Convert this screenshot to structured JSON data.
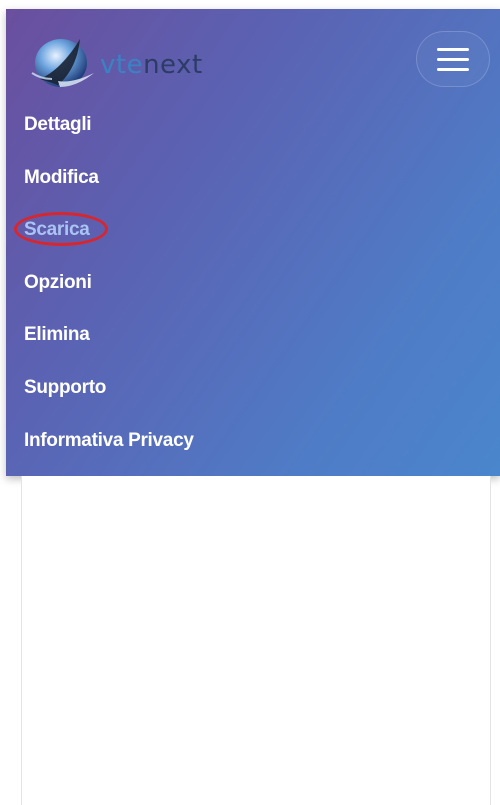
{
  "header": {
    "logo_text_vte": "vte",
    "logo_text_next": "next",
    "menu_button_label": "Menu"
  },
  "nav": {
    "items": [
      {
        "label": "Dettagli"
      },
      {
        "label": "Modifica"
      },
      {
        "label": "Scarica",
        "highlighted": true
      },
      {
        "label": "Opzioni"
      },
      {
        "label": "Elimina"
      },
      {
        "label": "Supporto"
      },
      {
        "label": "Informativa Privacy"
      }
    ]
  },
  "colors": {
    "menu_gradient_start": "#6a4f9e",
    "menu_gradient_end": "#4a86cc",
    "highlight_text": "#a9c4f2",
    "annotation_ring": "#d8262e"
  }
}
